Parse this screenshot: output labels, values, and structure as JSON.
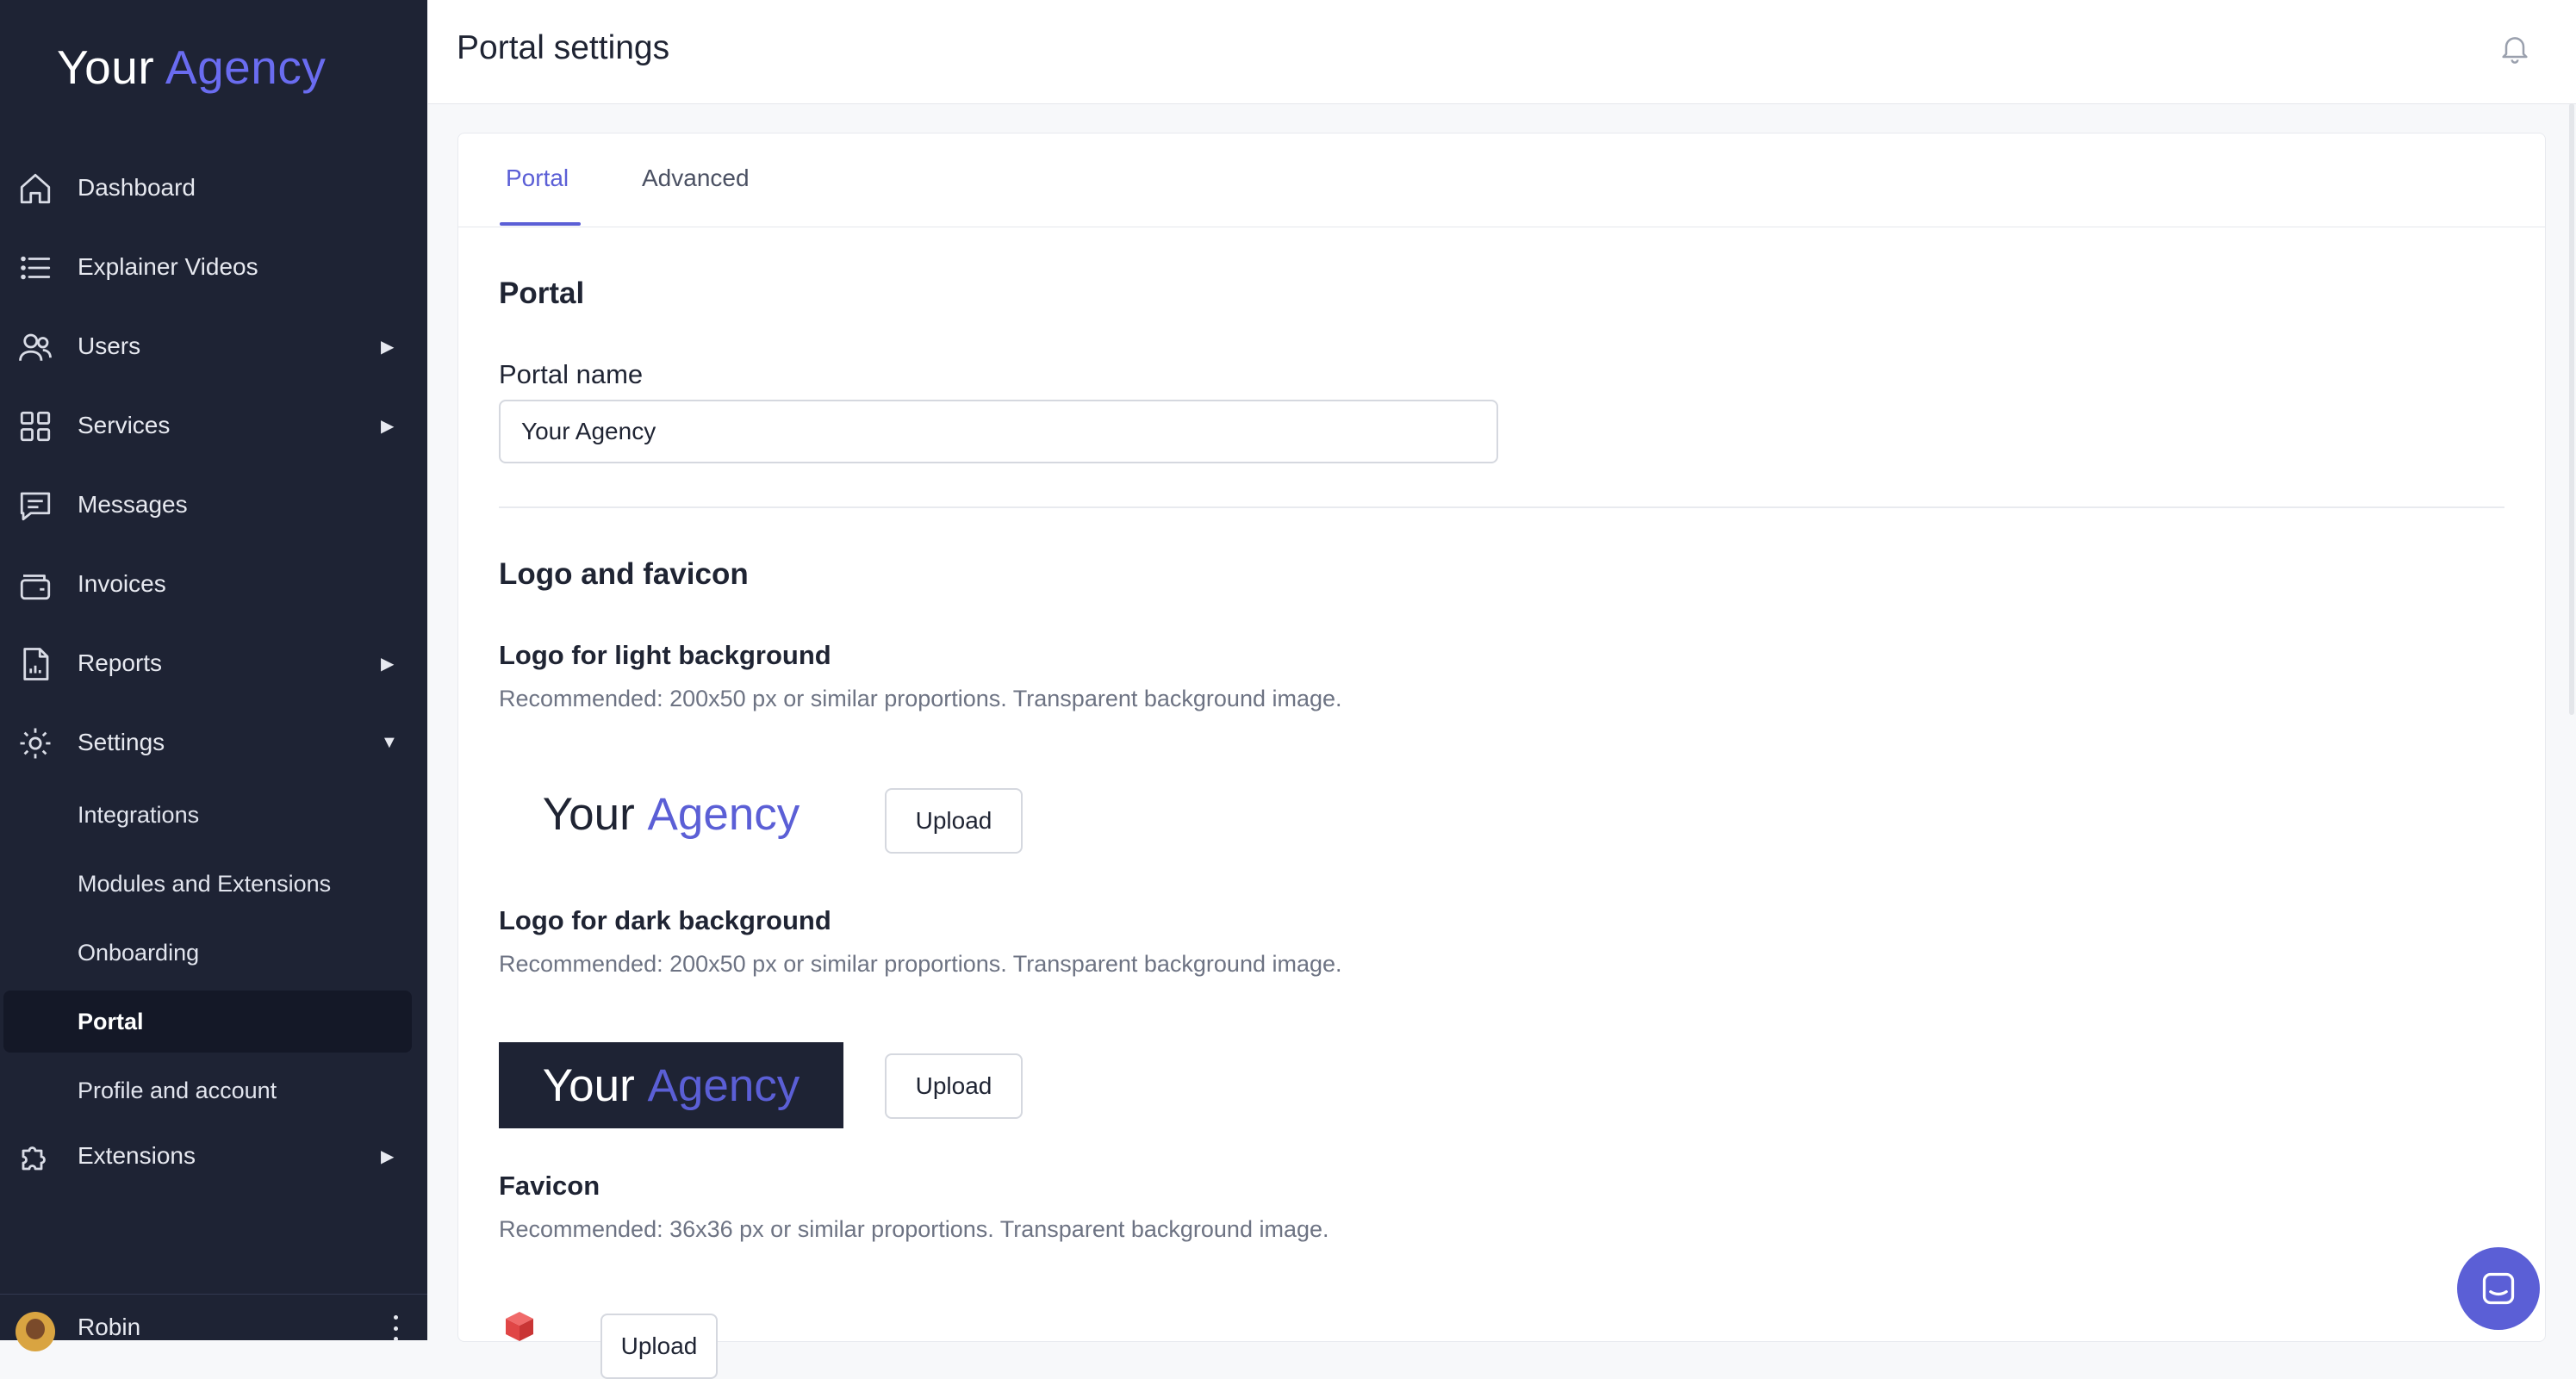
{
  "brand": {
    "part1": "Your",
    "part2": "Agency"
  },
  "sidebar": {
    "items": [
      {
        "label": "Dashboard",
        "icon": "home-icon",
        "arrow": ""
      },
      {
        "label": "Explainer Videos",
        "icon": "list-icon",
        "arrow": ""
      },
      {
        "label": "Users",
        "icon": "users-icon",
        "arrow": "▶"
      },
      {
        "label": "Services",
        "icon": "grid-icon",
        "arrow": "▶"
      },
      {
        "label": "Messages",
        "icon": "message-icon",
        "arrow": ""
      },
      {
        "label": "Invoices",
        "icon": "wallet-icon",
        "arrow": ""
      },
      {
        "label": "Reports",
        "icon": "report-icon",
        "arrow": "▶"
      },
      {
        "label": "Settings",
        "icon": "gear-icon",
        "arrow": "▼"
      },
      {
        "label": "Extensions",
        "icon": "puzzle-icon",
        "arrow": "▶"
      }
    ],
    "settings_sub": [
      {
        "label": "Integrations"
      },
      {
        "label": "Modules and Extensions"
      },
      {
        "label": "Onboarding"
      },
      {
        "label": "Portal",
        "active": true
      },
      {
        "label": "Profile and account"
      }
    ],
    "user": {
      "name": "Robin"
    }
  },
  "header": {
    "title": "Portal settings",
    "icon": "bell-icon"
  },
  "tabs": [
    {
      "label": "Portal",
      "active": true
    },
    {
      "label": "Advanced",
      "active": false
    }
  ],
  "portal_section": {
    "heading": "Portal",
    "name_label": "Portal name",
    "name_value": "Your Agency"
  },
  "logo_section": {
    "heading": "Logo and favicon",
    "light": {
      "title": "Logo for light background",
      "hint": "Recommended: 200x50 px or similar proportions. Transparent background image.",
      "upload_label": "Upload"
    },
    "dark": {
      "title": "Logo for dark background",
      "hint": "Recommended: 200x50 px or similar proportions. Transparent background image.",
      "upload_label": "Upload"
    },
    "favicon": {
      "title": "Favicon",
      "hint": "Recommended: 36x36 px or similar proportions. Transparent background image.",
      "upload_label": "Upload"
    }
  },
  "colors": {
    "sidebar_bg": "#1e2334",
    "accent": "#5b5fd6",
    "page_bg": "#f7f8fa"
  }
}
